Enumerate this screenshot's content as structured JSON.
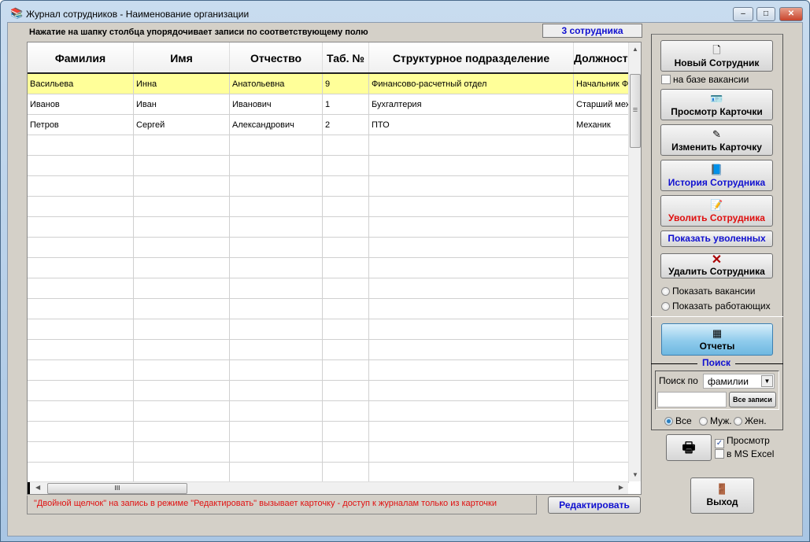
{
  "window": {
    "title": "Журнал сотрудников -  Наименование организации",
    "minimize": "–",
    "maximize": "□",
    "close": "✕"
  },
  "hint": "Нажатие на шапку столбца упорядочивает записи  по соответствующему полю",
  "count": "3 сотрудника",
  "table": {
    "columns": [
      "Фамилия",
      "Имя",
      "Отчество",
      "Таб. №",
      "Структурное подразделение",
      "Должность"
    ],
    "rows": [
      [
        "Васильева",
        "Инна",
        "Анатольевна",
        "9",
        "Финансово-расчетный отдел",
        "Начальник Ф"
      ],
      [
        "Иванов",
        "Иван",
        "Иванович",
        "1",
        "Бухгалтерия",
        "Старший мех"
      ],
      [
        "Петров",
        "Сергей",
        "Александрович",
        "2",
        "ПТО",
        "Механик"
      ]
    ],
    "selected_row": 0
  },
  "footer_note": "\"Двойной щелчок\" на запись в режиме \"Редактировать\" вызывает карточку  -  доступ к журналам только из карточки",
  "edit_button": "Редактировать",
  "panel": {
    "new_employee": "Новый Сотрудник",
    "on_vacancy": "на базе вакансии",
    "view_card": "Просмотр Карточки",
    "edit_card": "Изменить Карточку",
    "history": "История Сотрудника",
    "dismiss": "Уволить Сотрудника",
    "show_dismissed": "Показать уволенных",
    "delete": "Удалить Сотрудника",
    "show_vacancies": "Показать вакансии",
    "show_working": "Показать работающих",
    "reports": "Отчеты",
    "search_title": "Поиск",
    "search_by": "Поиск по",
    "search_field": "фамилии",
    "search_value": "",
    "all_records": "Все записи",
    "gender_all": "Все",
    "gender_male": "Муж.",
    "gender_female": "Жен.",
    "preview": "Просмотр",
    "preview_checked": true,
    "excel": "в MS Excel",
    "exit": "Выход"
  },
  "colors": {
    "selected_row": "#ffff99",
    "blue_text": "#1010d0",
    "red_text": "#e01010"
  }
}
